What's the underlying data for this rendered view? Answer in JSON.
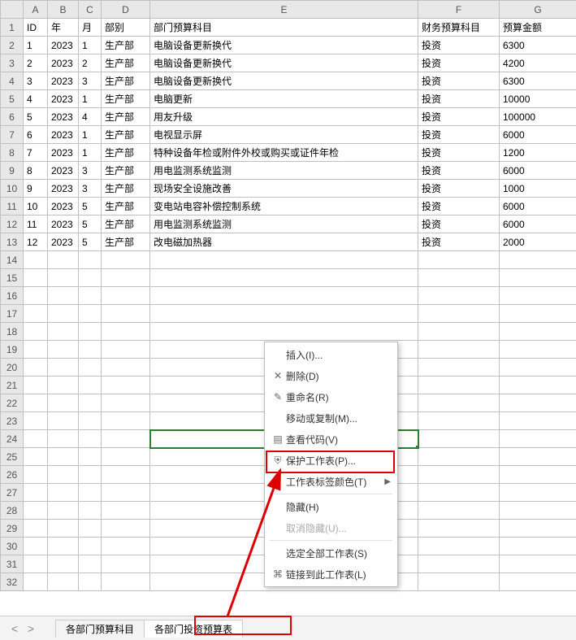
{
  "columns": [
    "A",
    "B",
    "C",
    "D",
    "E",
    "F",
    "G"
  ],
  "col_widths": [
    "colA",
    "colB",
    "colC",
    "colD",
    "colE",
    "colF",
    "colG"
  ],
  "headers": {
    "A": "ID",
    "B": "年",
    "C": "月",
    "D": "部别",
    "E": "部门预算科目",
    "F": "财务预算科目",
    "G": "预算金额"
  },
  "rows": [
    {
      "n": 2,
      "A": "1",
      "B": "2023",
      "C": "1",
      "D": "生产部",
      "E": "电脑设备更新换代",
      "F": "投资",
      "G": "6300"
    },
    {
      "n": 3,
      "A": "2",
      "B": "2023",
      "C": "2",
      "D": "生产部",
      "E": "电脑设备更新换代",
      "F": "投资",
      "G": "4200"
    },
    {
      "n": 4,
      "A": "3",
      "B": "2023",
      "C": "3",
      "D": "生产部",
      "E": "电脑设备更新换代",
      "F": "投资",
      "G": "6300"
    },
    {
      "n": 5,
      "A": "4",
      "B": "2023",
      "C": "1",
      "D": "生产部",
      "E": "电脑更新",
      "F": "投资",
      "G": "10000"
    },
    {
      "n": 6,
      "A": "5",
      "B": "2023",
      "C": "4",
      "D": "生产部",
      "E": "用友升级",
      "F": "投资",
      "G": "100000"
    },
    {
      "n": 7,
      "A": "6",
      "B": "2023",
      "C": "1",
      "D": "生产部",
      "E": "电视显示屏",
      "F": "投资",
      "G": "6000"
    },
    {
      "n": 8,
      "A": "7",
      "B": "2023",
      "C": "1",
      "D": "生产部",
      "E": "特种设备年检或附件外校或购买或证件年检",
      "F": "投资",
      "G": "1200"
    },
    {
      "n": 9,
      "A": "8",
      "B": "2023",
      "C": "3",
      "D": "生产部",
      "E": "用电监测系统监测",
      "F": "投资",
      "G": "6000"
    },
    {
      "n": 10,
      "A": "9",
      "B": "2023",
      "C": "3",
      "D": "生产部",
      "E": "现场安全设施改善",
      "F": "投资",
      "G": "1000"
    },
    {
      "n": 11,
      "A": "10",
      "B": "2023",
      "C": "5",
      "D": "生产部",
      "E": "变电站电容补偿控制系统",
      "F": "投资",
      "G": "6000"
    },
    {
      "n": 12,
      "A": "11",
      "B": "2023",
      "C": "5",
      "D": "生产部",
      "E": "用电监测系统监测",
      "F": "投资",
      "G": "6000"
    },
    {
      "n": 13,
      "A": "12",
      "B": "2023",
      "C": "5",
      "D": "生产部",
      "E": "改电磁加热器",
      "F": "投资",
      "G": "2000"
    }
  ],
  "empty_rows": [
    14,
    15,
    16,
    17,
    18,
    19,
    20,
    21,
    22,
    23,
    24,
    25,
    26,
    27,
    28,
    29,
    30,
    31,
    32
  ],
  "selected_row": 24,
  "menu": {
    "insert": "插入(I)...",
    "delete": "删除(D)",
    "rename": "重命名(R)",
    "movecopy": "移动或复制(M)...",
    "viewcode": "查看代码(V)",
    "protect": "保护工作表(P)...",
    "tabcolor": "工作表标签颜色(T)",
    "hide": "隐藏(H)",
    "unhide": "取消隐藏(U)...",
    "selectall": "选定全部工作表(S)",
    "link": "链接到此工作表(L)"
  },
  "tabs": {
    "prev": "<",
    "next": ">",
    "t1": "各部门预算科目",
    "t2": "各部门投资预算表"
  }
}
